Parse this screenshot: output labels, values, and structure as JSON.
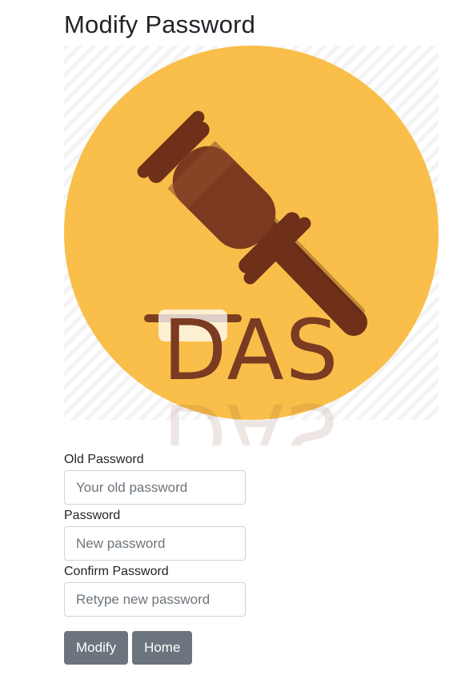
{
  "page": {
    "title": "Modify Password"
  },
  "logo": {
    "text": "DAS",
    "icon": "gavel-icon",
    "circle_color": "#f8b93a",
    "gavel_color": "#6e3019",
    "text_color": "#7a3b22"
  },
  "form": {
    "old_password": {
      "label": "Old Password",
      "placeholder": "Your old password",
      "value": ""
    },
    "new_password": {
      "label": "Password",
      "placeholder": "New password",
      "value": ""
    },
    "confirm_password": {
      "label": "Confirm Password",
      "placeholder": "Retype new password",
      "value": ""
    }
  },
  "buttons": {
    "modify": "Modify",
    "home": "Home"
  },
  "colors": {
    "button_bg": "#6c757d",
    "input_border": "#ced4da"
  }
}
